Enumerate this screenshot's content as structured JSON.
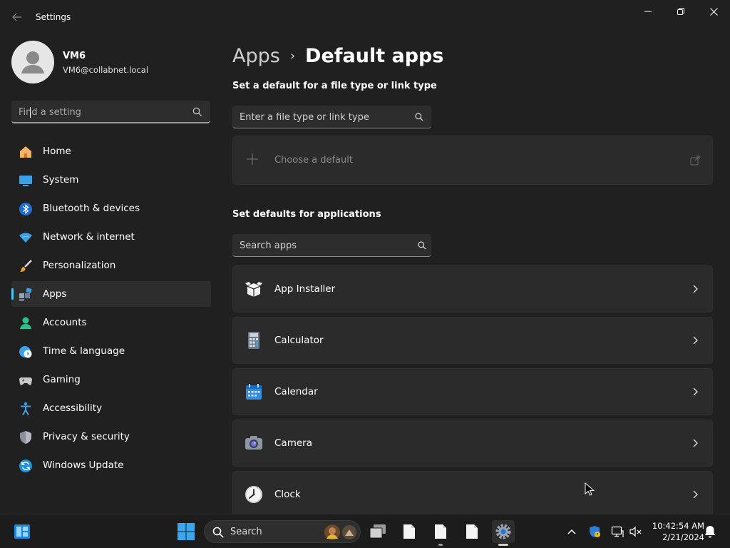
{
  "window": {
    "app_title": "Settings"
  },
  "profile": {
    "name": "VM6",
    "email": "VM6@collabnet.local"
  },
  "find_setting": {
    "placeholder": "Find a setting"
  },
  "nav": {
    "items": [
      {
        "label": "Home",
        "icon": "home-icon"
      },
      {
        "label": "System",
        "icon": "system-icon"
      },
      {
        "label": "Bluetooth & devices",
        "icon": "bluetooth-icon"
      },
      {
        "label": "Network & internet",
        "icon": "wifi-icon"
      },
      {
        "label": "Personalization",
        "icon": "brush-icon"
      },
      {
        "label": "Apps",
        "icon": "apps-icon",
        "active": true
      },
      {
        "label": "Accounts",
        "icon": "accounts-icon"
      },
      {
        "label": "Time & language",
        "icon": "time-language-icon"
      },
      {
        "label": "Gaming",
        "icon": "gamepad-icon"
      },
      {
        "label": "Accessibility",
        "icon": "accessibility-icon"
      },
      {
        "label": "Privacy & security",
        "icon": "shield-icon"
      },
      {
        "label": "Windows Update",
        "icon": "update-icon"
      }
    ]
  },
  "breadcrumb": {
    "parent": "Apps",
    "separator": "›",
    "current": "Default apps"
  },
  "file_type_section": {
    "title": "Set a default for a file type or link type",
    "search_placeholder": "Enter a file type or link type",
    "choose_default_label": "Choose a default"
  },
  "applications_section": {
    "title": "Set defaults for applications",
    "search_placeholder": "Search apps",
    "apps": [
      {
        "name": "App Installer",
        "icon": "app-installer-icon"
      },
      {
        "name": "Calculator",
        "icon": "calculator-icon"
      },
      {
        "name": "Calendar",
        "icon": "calendar-icon"
      },
      {
        "name": "Camera",
        "icon": "camera-icon"
      },
      {
        "name": "Clock",
        "icon": "clock-icon"
      }
    ]
  },
  "taskbar": {
    "search_label": "Search",
    "time": "10:42:54 AM",
    "date": "2/21/2024"
  },
  "colors": {
    "accent": "#4cc2ff",
    "window_bg": "#202020",
    "card_bg": "#2b2b2b"
  }
}
